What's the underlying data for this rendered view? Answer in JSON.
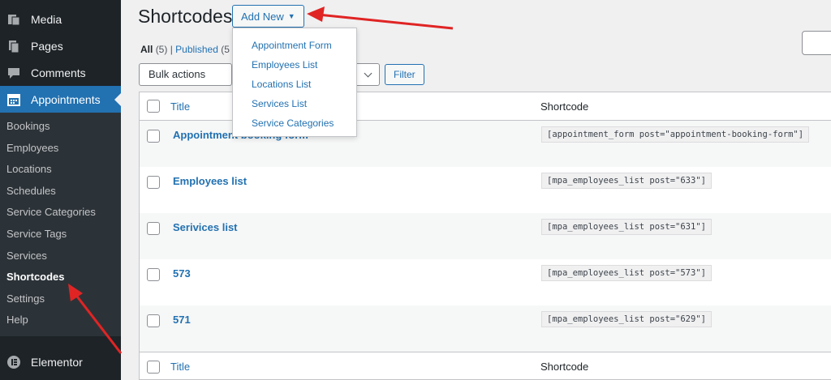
{
  "sidebar": {
    "top_items": [
      {
        "label": "Media",
        "icon": "media-icon"
      },
      {
        "label": "Pages",
        "icon": "pages-icon"
      },
      {
        "label": "Comments",
        "icon": "comments-icon"
      },
      {
        "label": "Appointments",
        "icon": "calendar-icon"
      }
    ],
    "submenu": [
      "Bookings",
      "Employees",
      "Locations",
      "Schedules",
      "Service Categories",
      "Service Tags",
      "Services",
      "Shortcodes",
      "Settings",
      "Help"
    ],
    "active_submenu": "Shortcodes",
    "elementor": {
      "label": "Elementor",
      "icon": "elementor-icon"
    }
  },
  "header": {
    "title": "Shortcodes",
    "add_new_label": "Add New"
  },
  "add_new_menu": [
    "Appointment Form",
    "Employees List",
    "Locations List",
    "Services List",
    "Service Categories"
  ],
  "views": {
    "all_label": "All",
    "all_count": "(5)",
    "separator": "|",
    "published_label": "Published",
    "published_count": "(5"
  },
  "toolbar": {
    "bulk_actions": "Bulk actions",
    "filter_label": "Filter"
  },
  "table": {
    "columns": [
      "Title",
      "Shortcode"
    ],
    "rows": [
      {
        "title": "Appointment booking form",
        "shortcode": "[appointment_form post=\"appointment-booking-form\"]"
      },
      {
        "title": "Employees list",
        "shortcode": "[mpa_employees_list post=\"633\"]"
      },
      {
        "title": "Serivices list",
        "shortcode": "[mpa_employees_list post=\"631\"]"
      },
      {
        "title": "573",
        "shortcode": "[mpa_employees_list post=\"573\"]"
      },
      {
        "title": "571",
        "shortcode": "[mpa_employees_list post=\"629\"]"
      }
    ]
  },
  "colors": {
    "sidebar_bg": "#1d2327",
    "accent": "#2271b1",
    "arrow": "#e02424"
  }
}
